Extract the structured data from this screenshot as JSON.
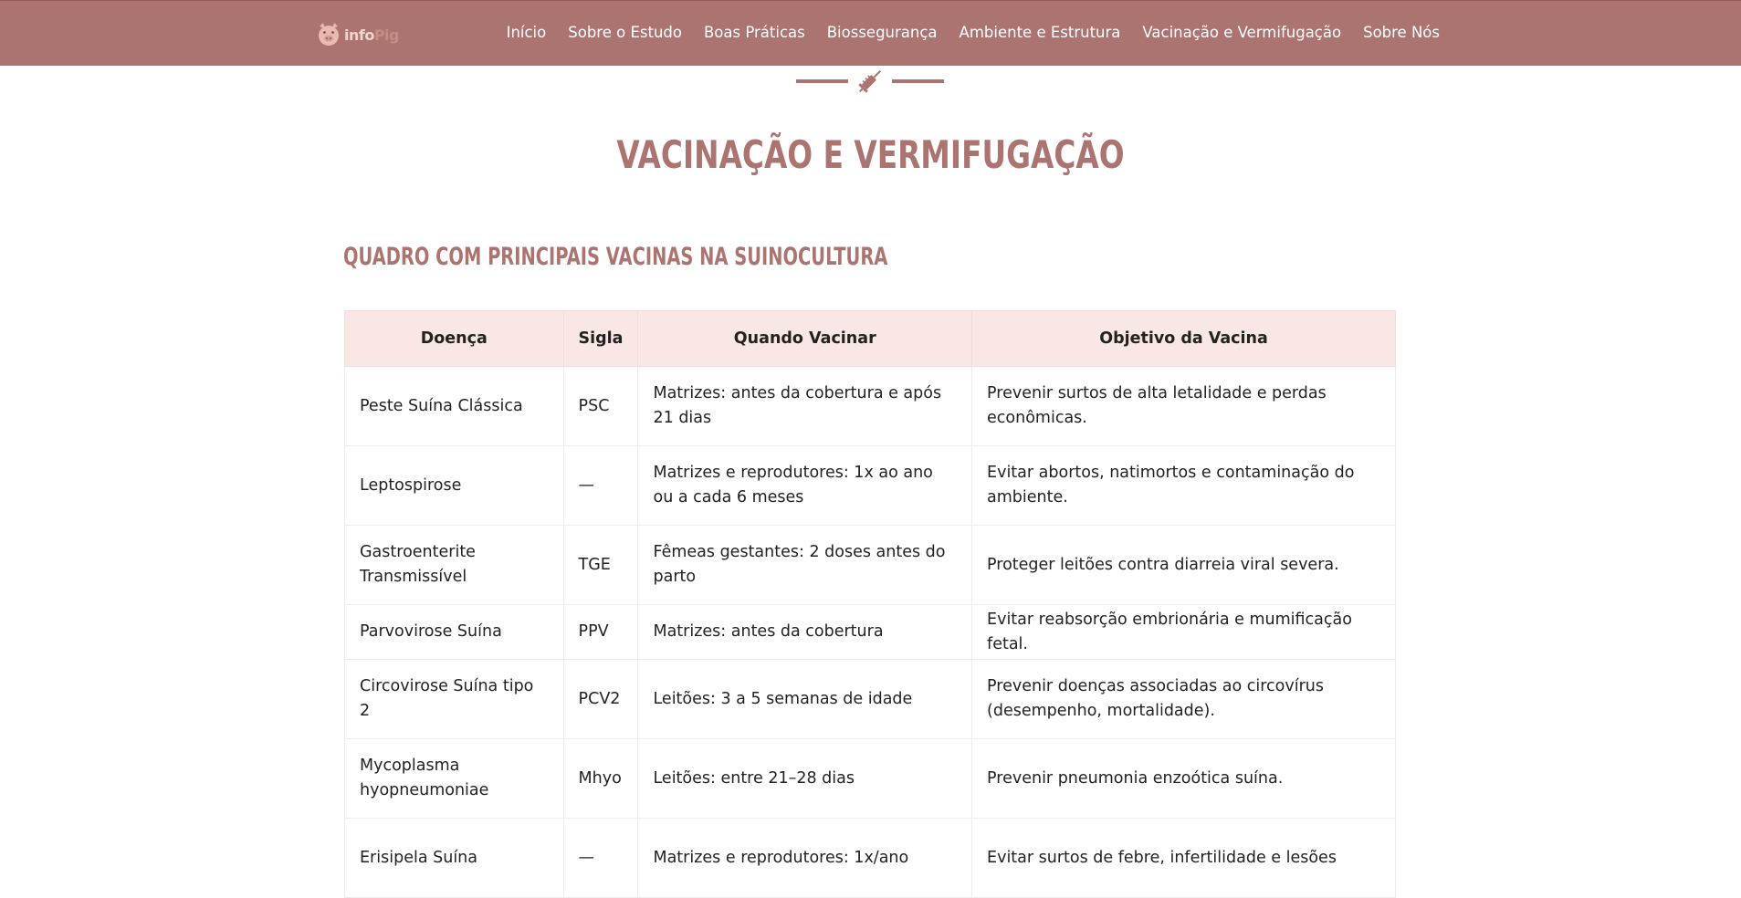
{
  "brand": {
    "logo_info": "info",
    "logo_pig": "Pig",
    "logo_icon": "pig-face-icon"
  },
  "nav": {
    "items": [
      "Início",
      "Sobre o Estudo",
      "Boas Práticas",
      "Biossegurança",
      "Ambiente e Estrutura",
      "Vacinação e Vermifugação",
      "Sobre Nós"
    ]
  },
  "divider_icon": "syringe-icon",
  "page": {
    "title": "VACINAÇÃO E VERMIFUGAÇÃO",
    "section_title": "QUADRO COM PRINCIPAIS VACINAS NA SUINOCULTURA"
  },
  "table": {
    "headers": [
      "Doença",
      "Sigla",
      "Quando Vacinar",
      "Objetivo da Vacina"
    ],
    "rows": [
      [
        "Peste Suína Clássica",
        "PSC",
        "Matrizes: antes da cobertura e após 21 dias",
        "Prevenir surtos de alta letalidade e perdas econômicas."
      ],
      [
        "Leptospirose",
        "—",
        "Matrizes e reprodutores: 1x ao ano ou a cada 6 meses",
        "Evitar abortos, natimortos e contaminação do ambiente."
      ],
      [
        "Gastroenterite Transmissível",
        "TGE",
        "Fêmeas gestantes: 2 doses antes do parto",
        "Proteger leitões contra diarreia viral severa."
      ],
      [
        "Parvovirose Suína",
        "PPV",
        "Matrizes: antes da cobertura",
        "Evitar reabsorção embrionária e mumificação fetal."
      ],
      [
        "Circovirose Suína tipo 2",
        "PCV2",
        "Leitões: 3 a 5 semanas de idade",
        "Prevenir doenças associadas ao circovírus (desempenho, mortalidade)."
      ],
      [
        "Mycoplasma hyopneumoniae",
        "Mhyo",
        "Leitões: entre 21–28 dias",
        "Prevenir pneumonia enzoótica suína."
      ],
      [
        "Erisipela Suína",
        "—",
        "Matrizes e reprodutores: 1x/ano",
        "Evitar surtos de febre, infertilidade e lesões"
      ]
    ]
  },
  "colors": {
    "accent": "#ab7470",
    "header_bg": "#f8e7e4"
  }
}
